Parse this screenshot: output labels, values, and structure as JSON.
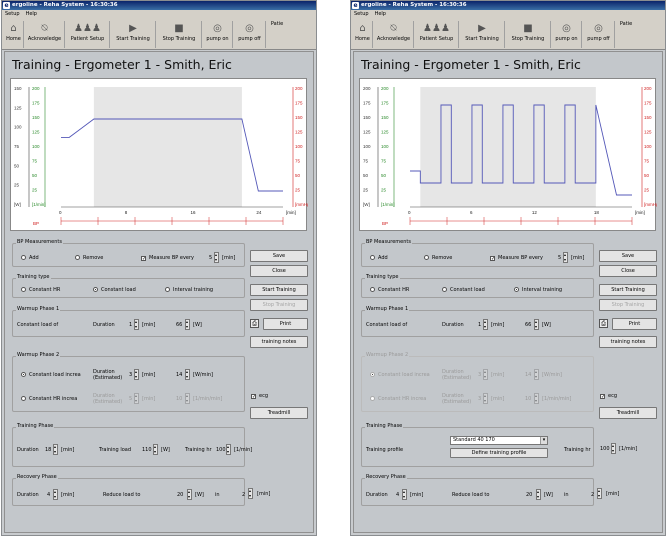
{
  "app": {
    "title": "ergoline - Reha System - 16:30:36",
    "menu": [
      "Setup",
      "Help"
    ]
  },
  "toolbar": [
    "Home",
    "Acknowledge",
    "Patient Setup",
    "Start Training",
    "Stop Training",
    "pump on",
    "pump off",
    "Patie"
  ],
  "heading": "Training - Ergometer 1 -   Smith, Eric",
  "left_chart": {
    "x_ticks": [
      "0",
      "8",
      "16",
      "24"
    ],
    "x_unit": "[min]",
    "y_left_outer": [
      "150",
      "125",
      "100",
      "75",
      "50",
      "25",
      "[W]"
    ],
    "y_left_inner": [
      "200",
      "175",
      "150",
      "125",
      "100",
      "75",
      "50",
      "25",
      "[1/min]"
    ],
    "y_right": [
      "200",
      "175",
      "150",
      "125",
      "100",
      "75",
      "50",
      "25",
      "[mmHg]"
    ],
    "bp_label": "BP"
  },
  "right_chart": {
    "x_ticks": [
      "0",
      "6",
      "12",
      "18"
    ],
    "x_unit": "[min]",
    "y_left_outer": [
      "200",
      "175",
      "150",
      "125",
      "100",
      "75",
      "50",
      "25",
      "[W]"
    ],
    "y_left_inner": [
      "200",
      "175",
      "150",
      "125",
      "100",
      "75",
      "50",
      "25",
      "[1/min]"
    ],
    "y_right": [
      "200",
      "175",
      "150",
      "125",
      "100",
      "75",
      "50",
      "25",
      "[mmHg]"
    ],
    "bp_label": "BP"
  },
  "chart_data": [
    {
      "type": "line",
      "x": [
        0,
        1,
        4,
        22,
        24,
        27
      ],
      "y": [
        87,
        87,
        110,
        110,
        20,
        20
      ],
      "xlim": [
        0,
        27
      ],
      "ylim": [
        0,
        150
      ]
    },
    {
      "type": "line",
      "x": [
        0,
        1,
        1,
        3,
        3,
        4,
        4,
        6,
        6,
        7,
        7,
        9,
        9,
        10,
        10,
        12,
        12,
        13,
        13,
        15,
        15,
        16,
        16,
        18,
        18,
        20,
        20,
        21.5
      ],
      "y": [
        60,
        60,
        40,
        40,
        170,
        170,
        40,
        40,
        170,
        170,
        40,
        40,
        170,
        170,
        40,
        40,
        170,
        170,
        40,
        40,
        170,
        170,
        40,
        40,
        170,
        20,
        20,
        20
      ],
      "xlim": [
        0,
        21.5
      ],
      "ylim": [
        0,
        200
      ]
    }
  ],
  "left": {
    "bp": {
      "title": "BP Measurements",
      "add": "Add",
      "remove": "Remove",
      "measure": "Measure BP every",
      "measure_val": "5",
      "unit": "[min]"
    },
    "type": {
      "title": "Training type",
      "hr": "Constant HR",
      "load": "Constant load",
      "interval": "Interval training"
    },
    "w1": {
      "title": "Warmup Phase 1",
      "label": "Constant load of",
      "duration": "Duration",
      "dur_val": "1",
      "dur_unit": "[min]",
      "load_val": "66",
      "load_unit": "[W]"
    },
    "w2": {
      "title": "Warmup Phase 2",
      "opt1": "Constant load increa",
      "opt2": "Constant HR increa",
      "dur": "Duration",
      "est": "(Estimated)",
      "val1": "3",
      "u1": "[min]",
      "val2": "14",
      "u2": "[W/min]",
      "val3": "5",
      "u3": "[min]",
      "val4": "10",
      "u4": "[1/min/min]"
    },
    "tp": {
      "title": "Training Phase",
      "duration": "Duration",
      "dur_val": "18",
      "dur_unit": "[min]",
      "load": "Training load",
      "load_val": "110",
      "load_unit": "[W]",
      "hr": "Training hr",
      "hr_val": "100",
      "hr_unit": "[1/min]"
    },
    "rp": {
      "title": "Recovery Phase",
      "duration": "Duration",
      "dur_val": "4",
      "dur_unit": "[min]",
      "reduce": "Reduce load to",
      "red_val": "20",
      "red_unit": "[W]",
      "in": "in",
      "in_val": "2",
      "in_unit": "[min]"
    },
    "buttons": {
      "save": "Save",
      "close": "Close",
      "start": "Start Training",
      "stop": "Stop Training",
      "print": "Print",
      "notes": "training notes",
      "ecg": "ecg",
      "treadmill": "Treadmill"
    }
  },
  "right": {
    "bp": {
      "title": "BP Measurements",
      "add": "Add",
      "remove": "Remove",
      "measure": "Measure BP every",
      "measure_val": "5",
      "unit": "[min]"
    },
    "type": {
      "title": "Training type",
      "hr": "Constant HR",
      "load": "Constant load",
      "interval": "Interval training"
    },
    "w1": {
      "title": "Warmup Phase 1",
      "label": "Constant load of",
      "duration": "Duration",
      "dur_val": "1",
      "dur_unit": "[min]",
      "load_val": "66",
      "load_unit": "[W]"
    },
    "w2": {
      "title": "Warmup Phase 2",
      "opt1": "Constant load increa",
      "opt2": "Constant HR increa",
      "dur": "Duration",
      "est": "(Estimated)",
      "val1": "3",
      "u1": "[min]",
      "val2": "14",
      "u2": "[W/min]",
      "val3": "3",
      "u3": "[min]",
      "val4": "10",
      "u4": "[1/min/min]"
    },
    "tp": {
      "title": "Training Phase",
      "profile": "Training profile",
      "profile_val": "Standard 40 170",
      "define": "Define training profile",
      "hr": "Training hr",
      "hr_val": "100",
      "hr_unit": "[1/min]"
    },
    "rp": {
      "title": "Recovery Phase",
      "duration": "Duration",
      "dur_val": "4",
      "dur_unit": "[min]",
      "reduce": "Reduce load to",
      "red_val": "20",
      "red_unit": "[W]",
      "in": "in",
      "in_val": "2",
      "in_unit": "[min]"
    },
    "buttons": {
      "save": "Save",
      "close": "Close",
      "start": "Start Training",
      "stop": "Stop Training",
      "print": "Print",
      "notes": "training notes",
      "ecg": "ecg",
      "treadmill": "Treadmill"
    }
  }
}
